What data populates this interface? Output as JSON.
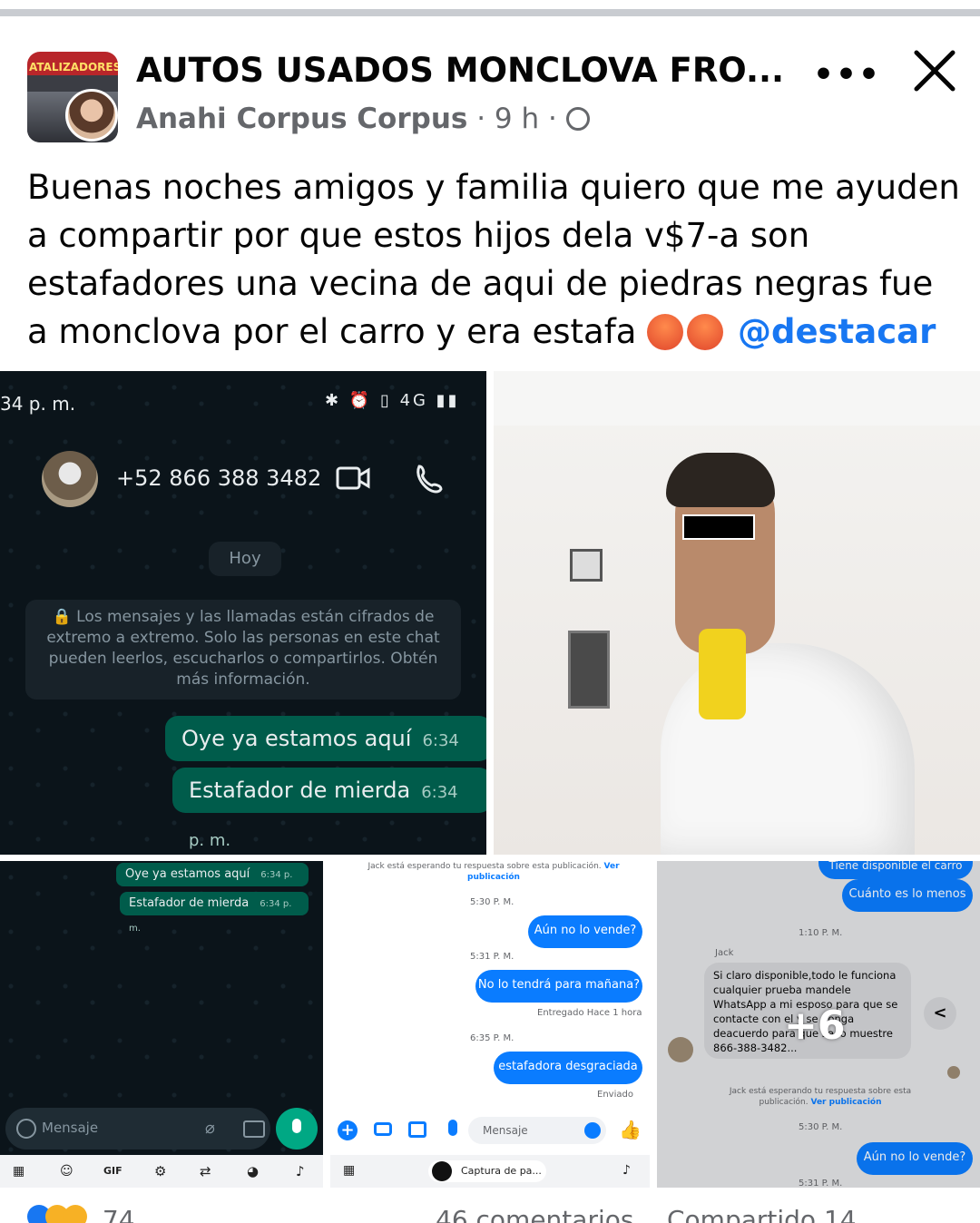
{
  "post": {
    "group_name": "AUTOS USADOS MONCLOVA FRO...",
    "author": "Anahi Corpus Corpus",
    "time": "· 9 h ·",
    "text_main": "Buenas noches amigos y familia quiero que me ayuden a compartir por que estos hijos dela v$7-a son estafadores una vecina de aqui de piedras negras fue a monclova por el carro y era estafa",
    "mention": "@destacar",
    "avatar_text": "ATALIZADORES",
    "more_label": "•••",
    "reactions_count": "74",
    "comments": "46 comentarios",
    "shares": "Compartido 14"
  },
  "wa_main": {
    "time_left": "34 p. m.",
    "phone": "+52 866 388 3482",
    "day": "Hoy",
    "encryption": "🔒 Los mensajes y las llamadas están cifrados de extremo a extremo. Solo las personas en este chat pueden leerlos, escucharlos o compartirlos. Obtén más información.",
    "msg1": "Oye ya estamos aquí",
    "msg1_time": "6:34 p. m.",
    "msg2": "Estafador de mierda",
    "msg2_time": "6:34 p. m."
  },
  "wa_small": {
    "msg1": "Oye ya estamos aquí",
    "msg1_time": "6:34 p. m.",
    "msg2": "Estafador de mierda",
    "msg2_time": "6:34 p. m.",
    "input_placeholder": "Mensaje",
    "kb_gif": "GIF"
  },
  "messenger_mid": {
    "waiting": "Jack está esperando tu respuesta sobre esta publicación.",
    "view_post": "Ver publicación",
    "t1": "5:30 P. M.",
    "m1": "Aún no lo vende?",
    "t2": "5:31 P. M.",
    "m2": "No lo tendrá para mañana?",
    "delivered": "Entregado Hace 1 hora",
    "t3": "6:35 P. M.",
    "m3": "estafadora desgraciada",
    "sent": "Enviado",
    "input_placeholder": "Mensaje",
    "screenshot_label": "Captura de pa..."
  },
  "messenger_right": {
    "top_msg": "Tiene disponible el carro",
    "m1": "Cuánto es lo menos",
    "t1": "1:10 P. M.",
    "sender": "Jack",
    "reply": "Si claro disponible,todo le funciona cualquier prueba mandele WhatsApp a mi esposo para que se contacte con el y se ponga deacuerdo para que se lo muestre 866-388-3482...",
    "more_count": "+6",
    "waiting": "Jack está esperando tu respuesta sobre esta publicación.",
    "view_post": "Ver publicación",
    "t2": "5:30 P. M.",
    "m2": "Aún no lo vende?",
    "t3": "5:31 P. M."
  },
  "colors": {
    "accent": "#1877f2",
    "wa_bg": "#0b141a",
    "wa_bubble": "#005c4b",
    "messenger_blue": "#0a7cff"
  }
}
